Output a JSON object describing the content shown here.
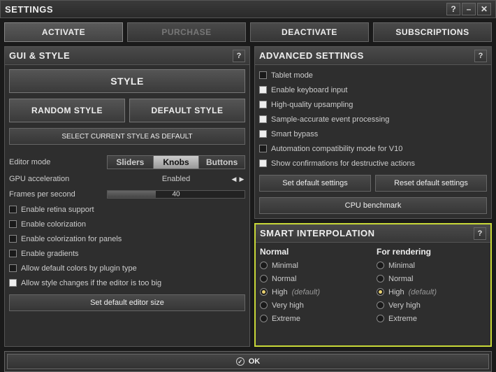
{
  "window": {
    "title": "SETTINGS"
  },
  "tabs": {
    "activate": "ACTIVATE",
    "purchase": "PURCHASE",
    "deactivate": "DEACTIVATE",
    "subscriptions": "SUBSCRIPTIONS"
  },
  "gui_style": {
    "title": "GUI & STYLE",
    "style_btn": "STYLE",
    "random_style_btn": "RANDOM STYLE",
    "default_style_btn": "DEFAULT STYLE",
    "select_current_btn": "SELECT CURRENT STYLE AS DEFAULT",
    "editor_mode_label": "Editor mode",
    "editor_mode_options": {
      "sliders": "Sliders",
      "knobs": "Knobs",
      "buttons": "Buttons"
    },
    "editor_mode_selected": "Knobs",
    "gpu_label": "GPU acceleration",
    "gpu_value": "Enabled",
    "fps_label": "Frames per second",
    "fps_value": "40",
    "checks": {
      "retina": "Enable retina support",
      "colorization": "Enable colorization",
      "colorization_panels": "Enable colorization for panels",
      "gradients": "Enable gradients",
      "default_colors": "Allow default colors by plugin type",
      "style_changes": "Allow style changes if the editor is too big"
    },
    "set_default_editor_size": "Set default editor size"
  },
  "advanced": {
    "title": "ADVANCED SETTINGS",
    "checks": {
      "tablet": "Tablet mode",
      "keyboard": "Enable keyboard input",
      "upsampling": "High-quality upsampling",
      "sample_accurate": "Sample-accurate event processing",
      "smart_bypass": "Smart bypass",
      "automation_compat": "Automation compatibility mode for V10",
      "confirmations": "Show confirmations for destructive actions"
    },
    "set_default_btn": "Set default settings",
    "reset_default_btn": "Reset default settings",
    "cpu_benchmark_btn": "CPU benchmark"
  },
  "smart_interpolation": {
    "title": "SMART INTERPOLATION",
    "normal_title": "Normal",
    "rendering_title": "For rendering",
    "options": {
      "minimal": "Minimal",
      "normal": "Normal",
      "high": "High",
      "very_high": "Very high",
      "extreme": "Extreme"
    },
    "default_tag": "(default)",
    "normal_selected": "high",
    "rendering_selected": "high"
  },
  "ok": "OK"
}
